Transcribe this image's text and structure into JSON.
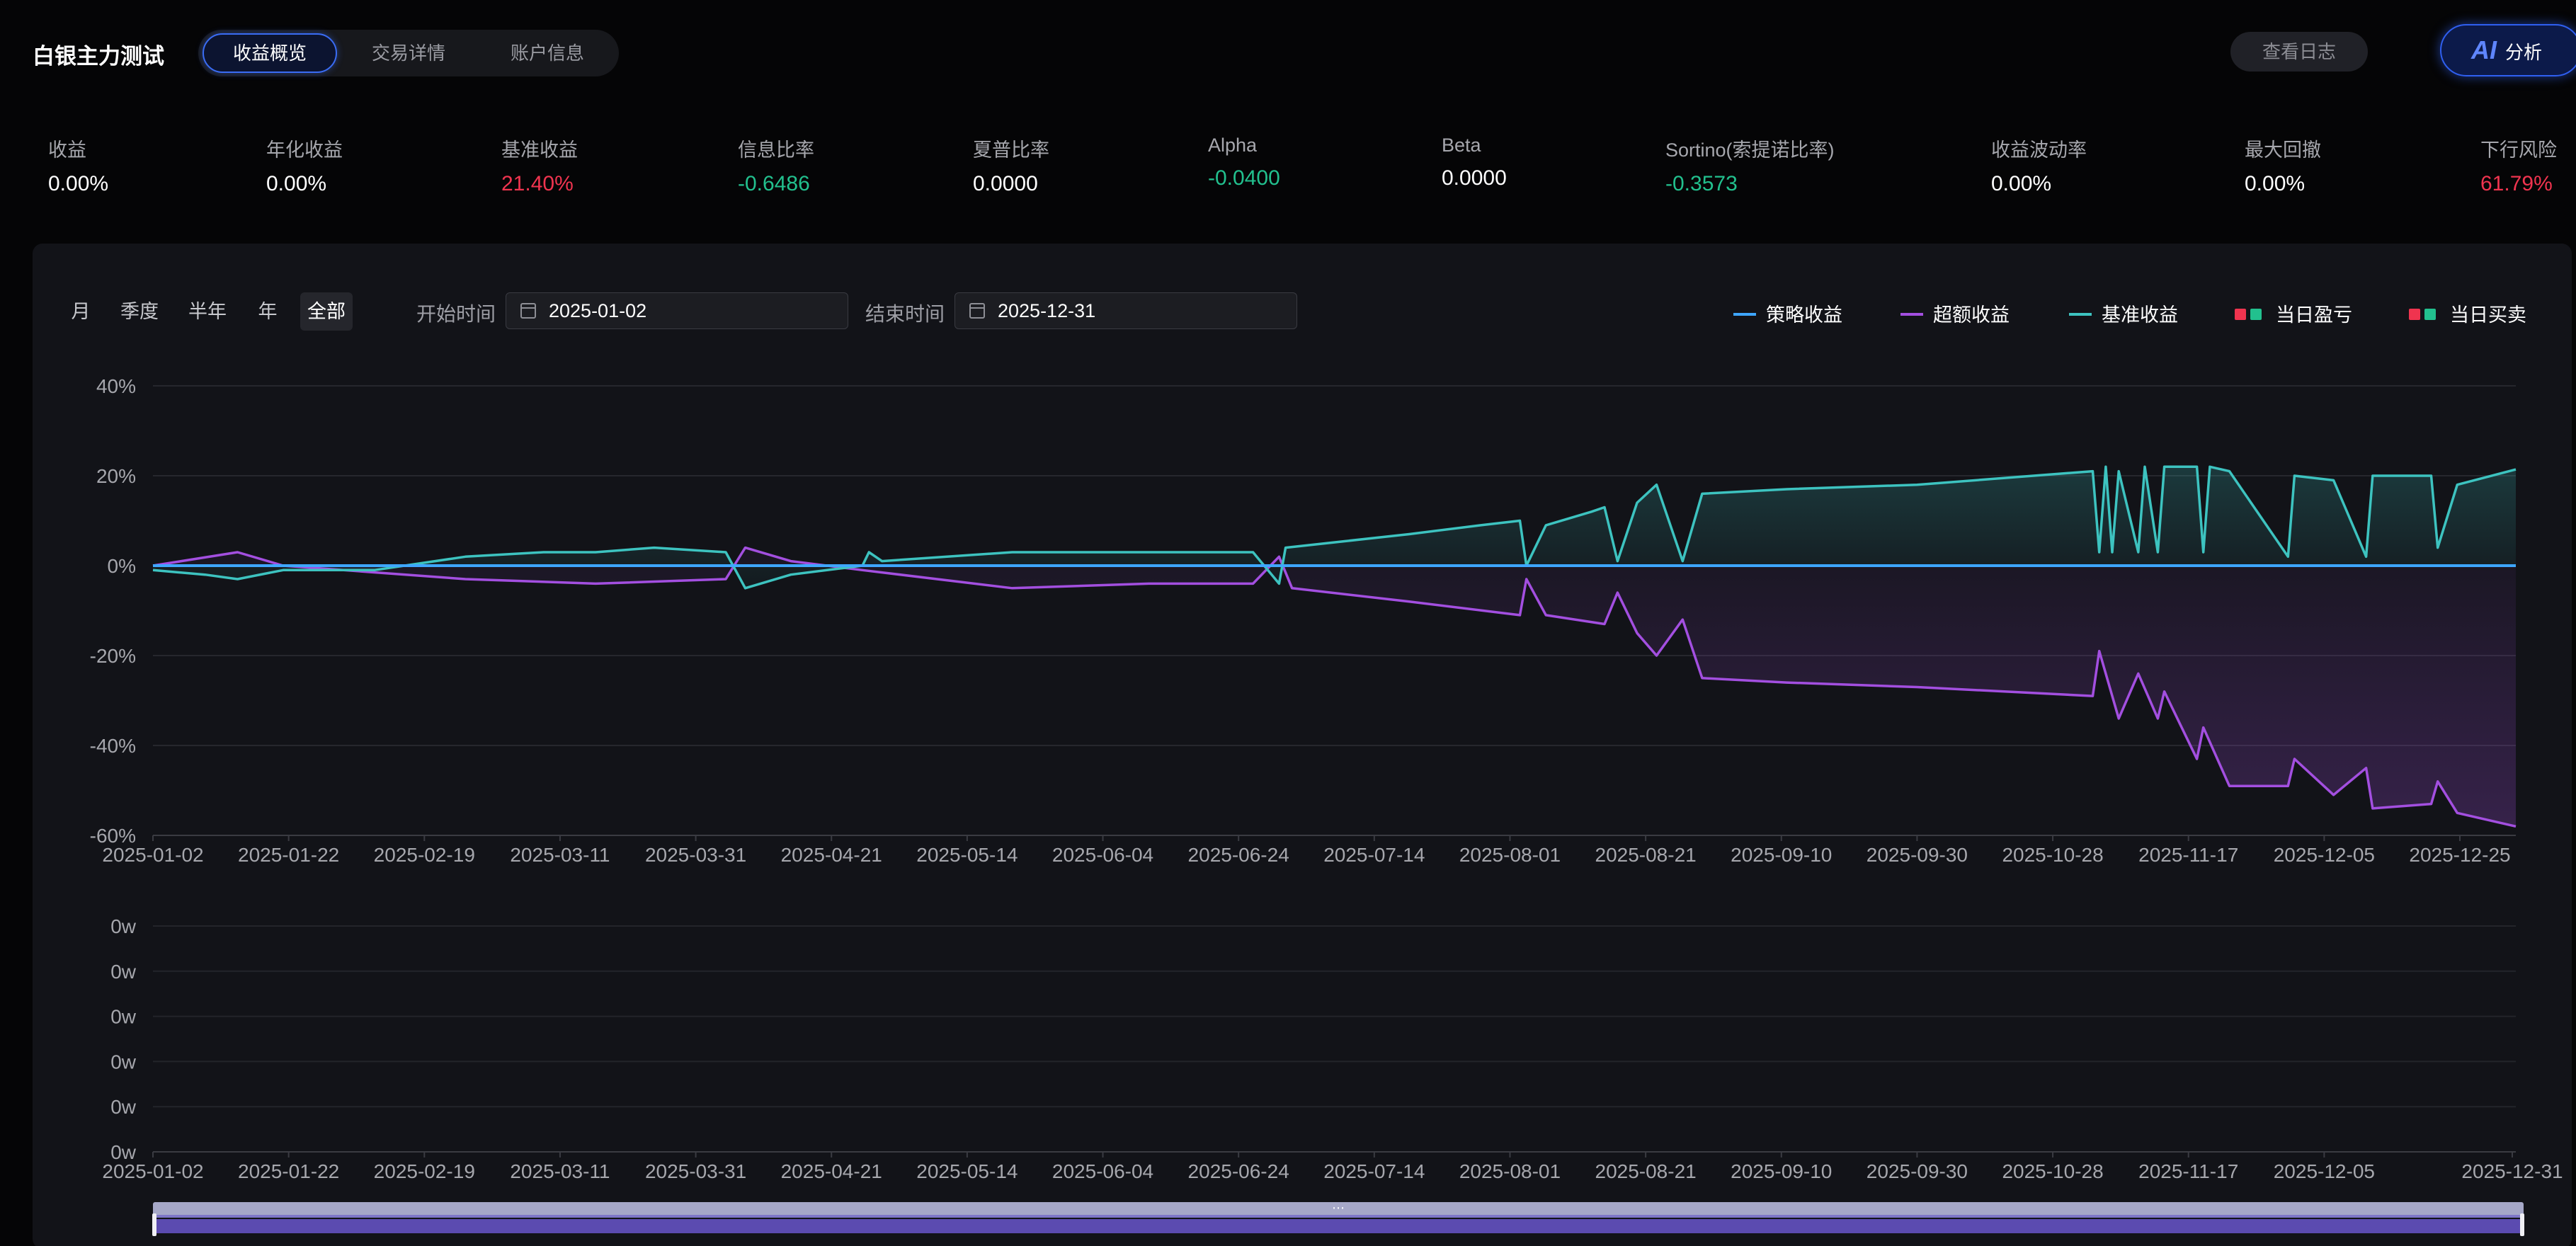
{
  "header": {
    "title": "白银主力测试",
    "tabs": [
      {
        "label": "收益概览",
        "active": true
      },
      {
        "label": "交易详情",
        "active": false
      },
      {
        "label": "账户信息",
        "active": false
      }
    ],
    "log_button": "查看日志",
    "ai_mark": "AI",
    "ai_button": "分析"
  },
  "metrics": [
    {
      "label": "收益",
      "value": "0.00%",
      "tone": "normal"
    },
    {
      "label": "年化收益",
      "value": "0.00%",
      "tone": "normal"
    },
    {
      "label": "基准收益",
      "value": "21.40%",
      "tone": "red"
    },
    {
      "label": "信息比率",
      "value": "-0.6486",
      "tone": "green"
    },
    {
      "label": "夏普比率",
      "value": "0.0000",
      "tone": "normal"
    },
    {
      "label": "Alpha",
      "value": "-0.0400",
      "tone": "green"
    },
    {
      "label": "Beta",
      "value": "0.0000",
      "tone": "normal"
    },
    {
      "label": "Sortino(索提诺比率)",
      "value": "-0.3573",
      "tone": "green"
    },
    {
      "label": "收益波动率",
      "value": "0.00%",
      "tone": "normal"
    },
    {
      "label": "最大回撤",
      "value": "0.00%",
      "tone": "normal"
    },
    {
      "label": "下行风险",
      "value": "61.79%",
      "tone": "red"
    }
  ],
  "controls": {
    "periods": [
      {
        "label": "月",
        "active": false
      },
      {
        "label": "季度",
        "active": false
      },
      {
        "label": "半年",
        "active": false
      },
      {
        "label": "年",
        "active": false
      },
      {
        "label": "全部",
        "active": true
      }
    ],
    "start_label": "开始时间",
    "start_value": "2025-01-02",
    "end_label": "结束时间",
    "end_value": "2025-12-31"
  },
  "colors": {
    "strategy": "#3ea6ff",
    "excess": "#a34fe0",
    "benchmark": "#3dc3c0",
    "loss_red": "#f0344f",
    "gain_green": "#22c08e",
    "accent": "#3a6cf4"
  },
  "chart_data": [
    {
      "type": "line",
      "legend": [
        {
          "name": "策略收益",
          "kind": "line",
          "color": "#3ea6ff"
        },
        {
          "name": "超额收益",
          "kind": "line",
          "color": "#a34fe0"
        },
        {
          "name": "基准收益",
          "kind": "line",
          "color": "#3dc3c0"
        },
        {
          "name": "当日盈亏",
          "kind": "bars",
          "colors": [
            "#f0344f",
            "#22c08e"
          ]
        },
        {
          "name": "当日买卖",
          "kind": "bars",
          "colors": [
            "#f0344f",
            "#22c08e"
          ]
        }
      ],
      "legend_position": "top-right",
      "x_tick_labels": [
        "2025-01-02",
        "2025-01-22",
        "2025-02-19",
        "2025-03-11",
        "2025-03-31",
        "2025-04-21",
        "2025-05-14",
        "2025-06-04",
        "2025-06-24",
        "2025-07-14",
        "2025-08-01",
        "2025-08-21",
        "2025-09-10",
        "2025-09-30",
        "2025-10-28",
        "2025-11-17",
        "2025-12-05",
        "2025-12-25"
      ],
      "y_tick_labels": [
        "40%",
        "20%",
        "0%",
        "-20%",
        "-40%",
        "-60%"
      ],
      "ylim": [
        -60,
        40
      ],
      "y_unit": "%",
      "grid": true,
      "series": [
        {
          "name": "策略收益",
          "color": "#3ea6ff",
          "points": [
            [
              "2025-01-02",
              0
            ],
            [
              "2025-12-31",
              0
            ]
          ]
        },
        {
          "name": "基准收益",
          "color": "#3dc3c0",
          "fill": true,
          "points": [
            [
              "2025-01-02",
              -1
            ],
            [
              "2025-01-10",
              -2
            ],
            [
              "2025-01-15",
              -3
            ],
            [
              "2025-01-22",
              -1
            ],
            [
              "2025-02-05",
              -1
            ],
            [
              "2025-02-19",
              2
            ],
            [
              "2025-03-03",
              3
            ],
            [
              "2025-03-11",
              3
            ],
            [
              "2025-03-20",
              4
            ],
            [
              "2025-03-31",
              3
            ],
            [
              "2025-04-03",
              -5
            ],
            [
              "2025-04-10",
              -2
            ],
            [
              "2025-04-21",
              0
            ],
            [
              "2025-04-22",
              3
            ],
            [
              "2025-04-24",
              1
            ],
            [
              "2025-05-14",
              3
            ],
            [
              "2025-06-04",
              3
            ],
            [
              "2025-06-20",
              3
            ],
            [
              "2025-06-24",
              -4
            ],
            [
              "2025-06-25",
              4
            ],
            [
              "2025-07-14",
              7
            ],
            [
              "2025-07-25",
              9
            ],
            [
              "2025-07-31",
              10
            ],
            [
              "2025-08-01",
              0
            ],
            [
              "2025-08-04",
              9
            ],
            [
              "2025-08-11",
              12
            ],
            [
              "2025-08-13",
              13
            ],
            [
              "2025-08-15",
              1
            ],
            [
              "2025-08-18",
              14
            ],
            [
              "2025-08-21",
              18
            ],
            [
              "2025-08-25",
              1
            ],
            [
              "2025-08-28",
              16
            ],
            [
              "2025-09-10",
              17
            ],
            [
              "2025-09-30",
              18
            ],
            [
              "2025-10-27",
              21
            ],
            [
              "2025-10-28",
              3
            ],
            [
              "2025-10-29",
              22
            ],
            [
              "2025-10-30",
              3
            ],
            [
              "2025-10-31",
              21
            ],
            [
              "2025-11-03",
              3
            ],
            [
              "2025-11-04",
              22
            ],
            [
              "2025-11-06",
              3
            ],
            [
              "2025-11-07",
              22
            ],
            [
              "2025-11-12",
              22
            ],
            [
              "2025-11-13",
              3
            ],
            [
              "2025-11-14",
              22
            ],
            [
              "2025-11-17",
              21
            ],
            [
              "2025-11-26",
              2
            ],
            [
              "2025-11-27",
              20
            ],
            [
              "2025-12-03",
              19
            ],
            [
              "2025-12-08",
              2
            ],
            [
              "2025-12-09",
              20
            ],
            [
              "2025-12-18",
              20
            ],
            [
              "2025-12-19",
              4
            ],
            [
              "2025-12-22",
              18
            ],
            [
              "2025-12-31",
              21.4
            ]
          ]
        },
        {
          "name": "超额收益",
          "color": "#a34fe0",
          "fill": true,
          "points": [
            [
              "2025-01-02",
              0
            ],
            [
              "2025-01-15",
              3
            ],
            [
              "2025-01-22",
              0
            ],
            [
              "2025-02-19",
              -3
            ],
            [
              "2025-03-11",
              -4
            ],
            [
              "2025-03-31",
              -3
            ],
            [
              "2025-04-03",
              4
            ],
            [
              "2025-04-10",
              1
            ],
            [
              "2025-04-21",
              -1
            ],
            [
              "2025-05-14",
              -5
            ],
            [
              "2025-06-04",
              -4
            ],
            [
              "2025-06-20",
              -4
            ],
            [
              "2025-06-24",
              2
            ],
            [
              "2025-06-26",
              -5
            ],
            [
              "2025-07-14",
              -8
            ],
            [
              "2025-07-31",
              -11
            ],
            [
              "2025-08-01",
              -3
            ],
            [
              "2025-08-04",
              -11
            ],
            [
              "2025-08-13",
              -13
            ],
            [
              "2025-08-15",
              -6
            ],
            [
              "2025-08-18",
              -15
            ],
            [
              "2025-08-21",
              -20
            ],
            [
              "2025-08-25",
              -12
            ],
            [
              "2025-08-28",
              -25
            ],
            [
              "2025-09-10",
              -26
            ],
            [
              "2025-09-30",
              -27
            ],
            [
              "2025-10-27",
              -29
            ],
            [
              "2025-10-28",
              -19
            ],
            [
              "2025-10-31",
              -34
            ],
            [
              "2025-11-03",
              -24
            ],
            [
              "2025-11-06",
              -34
            ],
            [
              "2025-11-07",
              -28
            ],
            [
              "2025-11-12",
              -43
            ],
            [
              "2025-11-13",
              -36
            ],
            [
              "2025-11-17",
              -49
            ],
            [
              "2025-11-26",
              -49
            ],
            [
              "2025-11-27",
              -43
            ],
            [
              "2025-12-03",
              -51
            ],
            [
              "2025-12-08",
              -45
            ],
            [
              "2025-12-09",
              -54
            ],
            [
              "2025-12-18",
              -53
            ],
            [
              "2025-12-19",
              -48
            ],
            [
              "2025-12-22",
              -55
            ],
            [
              "2025-12-31",
              -58
            ]
          ]
        }
      ]
    },
    {
      "type": "bar",
      "x_tick_labels": [
        "2025-01-02",
        "2025-01-22",
        "2025-02-19",
        "2025-03-11",
        "2025-03-31",
        "2025-04-21",
        "2025-05-14",
        "2025-06-04",
        "2025-06-24",
        "2025-07-14",
        "2025-08-01",
        "2025-08-21",
        "2025-09-10",
        "2025-09-30",
        "2025-10-28",
        "2025-11-17",
        "2025-12-05",
        "2025-12-31"
      ],
      "y_tick_labels": [
        "0w",
        "0w",
        "0w",
        "0w",
        "0w",
        "0w"
      ],
      "values": [],
      "grid": true
    }
  ]
}
